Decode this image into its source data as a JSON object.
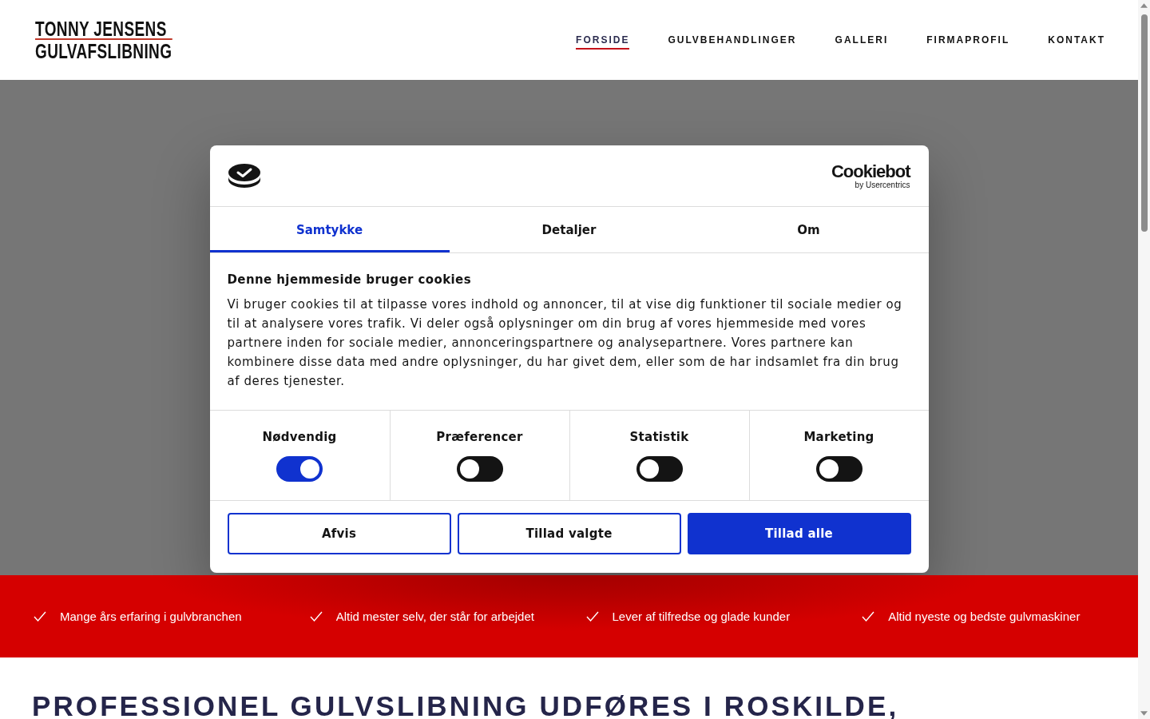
{
  "header": {
    "logo": {
      "lines": [
        "TONNY JENSENS",
        "GULVAFSLIBNING"
      ]
    },
    "nav": [
      {
        "label": "FORSIDE",
        "selected": true
      },
      {
        "label": "GULVBEHANDLINGER",
        "selected": false
      },
      {
        "label": "GALLERI",
        "selected": false
      },
      {
        "label": "FIRMAPROFIL",
        "selected": false
      },
      {
        "label": "KONTAKT",
        "selected": false
      }
    ]
  },
  "cookie_dialog": {
    "brand": {
      "name": "Cookiebot",
      "byline": "by Usercentrics"
    },
    "tabs": [
      {
        "label": "Samtykke",
        "selected": true
      },
      {
        "label": "Detaljer",
        "selected": false
      },
      {
        "label": "Om",
        "selected": false
      }
    ],
    "title": "Denne hjemmeside bruger cookies",
    "body": "Vi bruger cookies til at tilpasse vores indhold og annoncer, til at vise dig funktioner til sociale medier og til at analysere vores trafik. Vi deler også oplysninger om din brug af vores hjemmeside med vores partnere inden for sociale medier, annonceringspartnere og analysepartnere. Vores partnere kan kombinere disse data med andre oplysninger, du har givet dem, eller som de har indsamlet fra din brug af deres tjenester.",
    "categories": [
      {
        "label": "Nødvendig",
        "on": true
      },
      {
        "label": "Præferencer",
        "on": false
      },
      {
        "label": "Statistik",
        "on": false
      },
      {
        "label": "Marketing",
        "on": false
      }
    ],
    "buttons": [
      {
        "label": "Afvis",
        "kind": "outline"
      },
      {
        "label": "Tillad valgte",
        "kind": "outline"
      },
      {
        "label": "Tillad alle",
        "kind": "primary"
      }
    ]
  },
  "features": [
    {
      "text": "Mange års erfaring i gulvbranchen"
    },
    {
      "text": "Altid mester selv, der står for arbejdet"
    },
    {
      "text": "Lever af tilfredse og glade kunder"
    },
    {
      "text": "Altid nyeste og bedste gulvmaskiner"
    }
  ],
  "headline": "PROFESSIONEL GULVSLIBNING UDFØRES I ROSKILDE,"
}
